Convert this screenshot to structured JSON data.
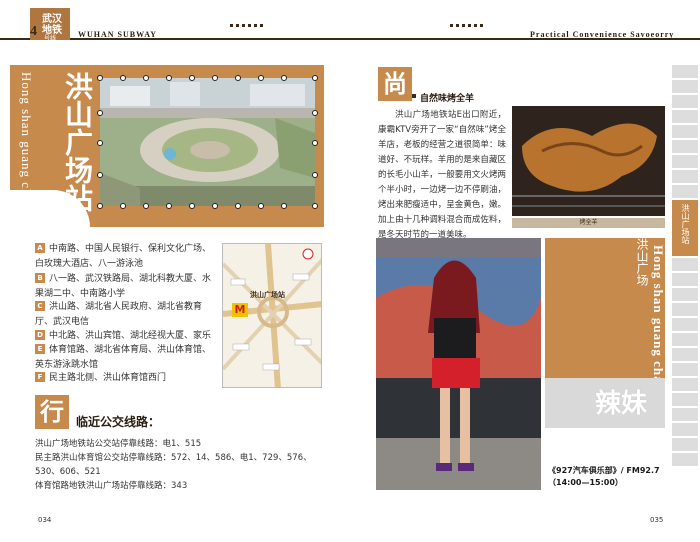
{
  "header": {
    "logo_line1": "武汉",
    "logo_line2": "地铁",
    "logo_number": "4",
    "logo_sub": "号线",
    "left_title": "WUHAN SUBWAY",
    "right_title": "Practical  Convenience  Savoeorry"
  },
  "station": {
    "name": "洪山广场站",
    "pinyin": "Hong shan guang chang"
  },
  "exits": [
    {
      "letter": "A",
      "text": "中南路、中国人民银行、保利文化广场、白玫瑰大酒店、八一游泳池"
    },
    {
      "letter": "B",
      "text": "八一路、武汉铁路局、湖北科教大厦、水果湖二中、中南路小学"
    },
    {
      "letter": "C",
      "text": "洪山路、湖北省人民政府、湖北省教育厅、武汉电信"
    },
    {
      "letter": "D",
      "text": "中北路、洪山宾馆、湖北经视大厦、家乐福"
    },
    {
      "letter": "E",
      "text": "体育馆路、湖北省体育局、洪山体育馆、英东游泳跳水馆"
    },
    {
      "letter": "F",
      "text": "民主路北侧、洪山体育馆西门"
    }
  ],
  "map": {
    "station_label": "洪山广场站",
    "station_letter": "M"
  },
  "bus": {
    "icon_char": "行",
    "title": "临近公交线路：",
    "lines": [
      "洪山广场地铁站公交站停靠线路：电1、515",
      "民主路洪山体育馆公交站停靠线路：572、14、586、电1、729、576、530、606、521",
      "体育馆路地铁洪山广场站停靠线路：343"
    ]
  },
  "page_left": "034",
  "page_right": "035",
  "food": {
    "icon_char": "尚",
    "subtitle": "自然味烤全羊",
    "paragraph": "洪山广场地铁站E出口附近，康霸KTV旁开了一家“自然味”烤全羊店，老板的经营之道很简单：味道好、不玩样。羊用的是来自藏区的长毛小山羊，一般要用文火烤两个半小时，一边烤一边不停刷油，烤出来肥瘦适中，呈金黄色，嫩。加上由十几种调料混合而成佐料，是冬天时节的一道美味。",
    "caption": "烤全羊"
  },
  "feature": {
    "cn_station": "洪山广场",
    "pinyin": "Hong shan guang chang",
    "title": "辣妹",
    "radio_line1": "《927汽车俱乐部》/ FM92.7",
    "radio_line2": "（14:00—15:00）"
  },
  "side_tab": {
    "active_label": "洪山广场站"
  },
  "colors": {
    "accent": "#c68a4c",
    "dark": "#3a2a1a"
  }
}
